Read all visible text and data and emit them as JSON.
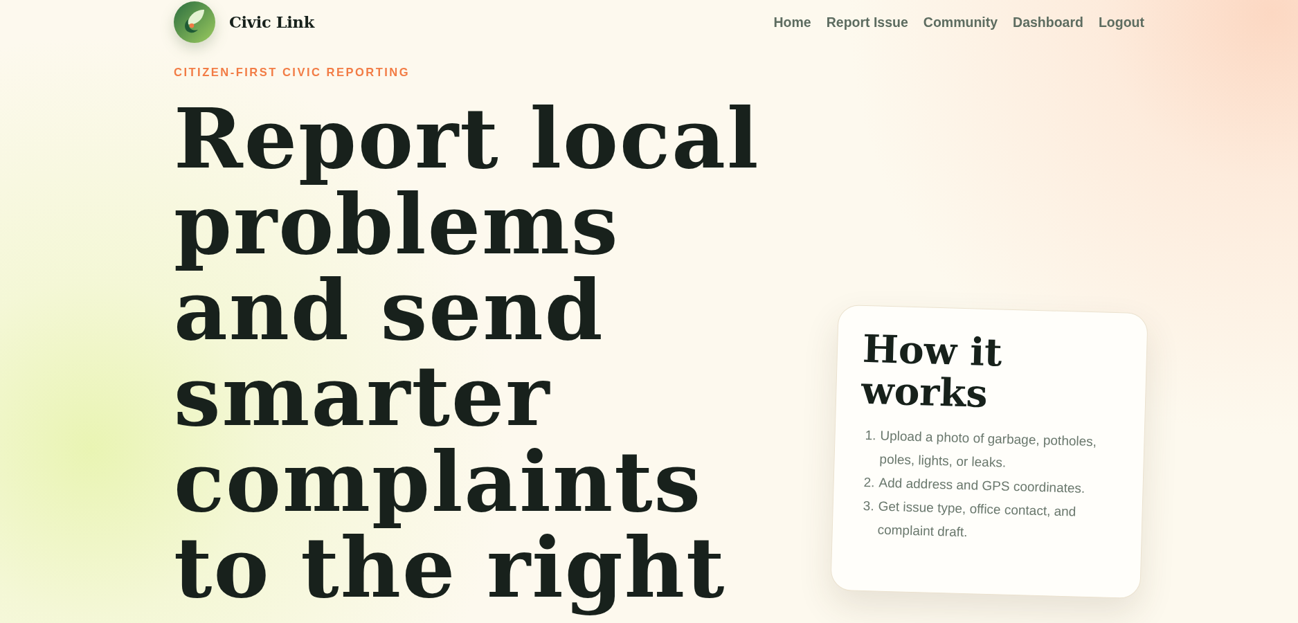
{
  "header": {
    "brand": "Civic Link",
    "nav": [
      "Home",
      "Report Issue",
      "Community",
      "Dashboard",
      "Logout"
    ]
  },
  "hero": {
    "eyebrow": "CITIZEN-FIRST CIVIC REPORTING",
    "title": "Report local problems and send smarter complaints to the right"
  },
  "card": {
    "title": "How it works",
    "steps": [
      {
        "number": "1.",
        "text": "Upload a photo of garbage, potholes, poles, lights, or leaks."
      },
      {
        "number": "2.",
        "text": "Add address and GPS coordinates."
      },
      {
        "number": "3.",
        "text": "Get issue type, office contact, and complaint draft."
      }
    ]
  }
}
